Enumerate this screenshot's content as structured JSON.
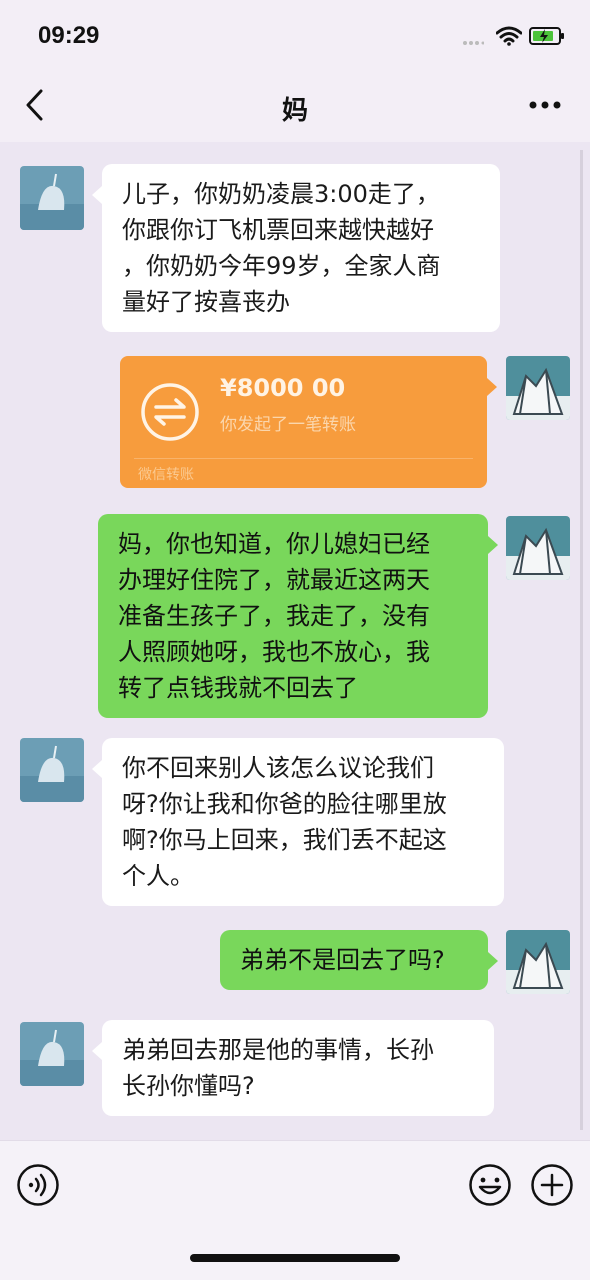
{
  "status_bar": {
    "time": "09:29"
  },
  "nav": {
    "title": "妈"
  },
  "messages": [
    {
      "side": "in",
      "lines": [
        "儿子，你奶奶凌晨3:00走了，",
        "你跟你订飞机票回来越快越好",
        "，你奶奶今年99岁，全家人商",
        "量好了按喜丧办"
      ]
    },
    {
      "side": "out",
      "type": "transfer",
      "amount": "¥8000 00",
      "description": "你发起了一笔转账",
      "footer": "微信转账"
    },
    {
      "side": "out",
      "lines": [
        "妈，你也知道，你儿媳妇已经",
        "办理好住院了，就最近这两天",
        "准备生孩子了，我走了，没有",
        "人照顾她呀，我也不放心，我",
        "转了点钱我就不回去了"
      ]
    },
    {
      "side": "in",
      "lines": [
        "你不回来别人该怎么议论我们",
        "呀?你让我和你爸的脸往哪里放",
        "啊?你马上回来，我们丢不起这",
        "个人。"
      ]
    },
    {
      "side": "out",
      "lines": [
        "弟弟不是回去了吗?"
      ]
    },
    {
      "side": "in",
      "lines": [
        "弟弟回去那是他的事情，长孙",
        "长孙你懂吗?"
      ]
    }
  ],
  "icons": {
    "back": "chevron-left-icon",
    "more": "more-dots-icon",
    "voice": "voice-icon",
    "emoji": "emoji-icon",
    "plus": "plus-icon",
    "transfer": "transfer-arrows-icon"
  },
  "colors": {
    "background": "#ece6f2",
    "incoming_bubble": "#ffffff",
    "outgoing_bubble": "#79d75b",
    "transfer_card": "#f79c3d"
  }
}
